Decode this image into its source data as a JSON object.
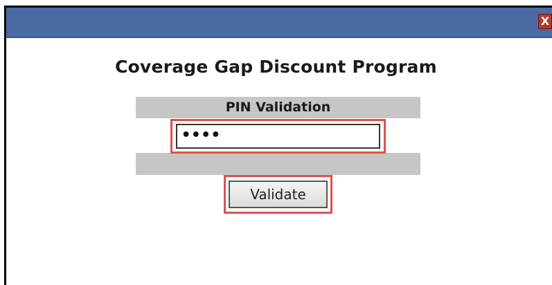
{
  "dialog": {
    "close_label": "X",
    "heading": "Coverage Gap Discount Program",
    "pin_section_label": "PIN Validation",
    "pin_value": "••••",
    "validate_label": "Validate"
  },
  "colors": {
    "titlebar": "#4a6aa5",
    "close_button": "#b23a2a",
    "band": "#c6c6c6",
    "highlight": "#e0504a"
  },
  "icons": {
    "close": "close-icon"
  }
}
